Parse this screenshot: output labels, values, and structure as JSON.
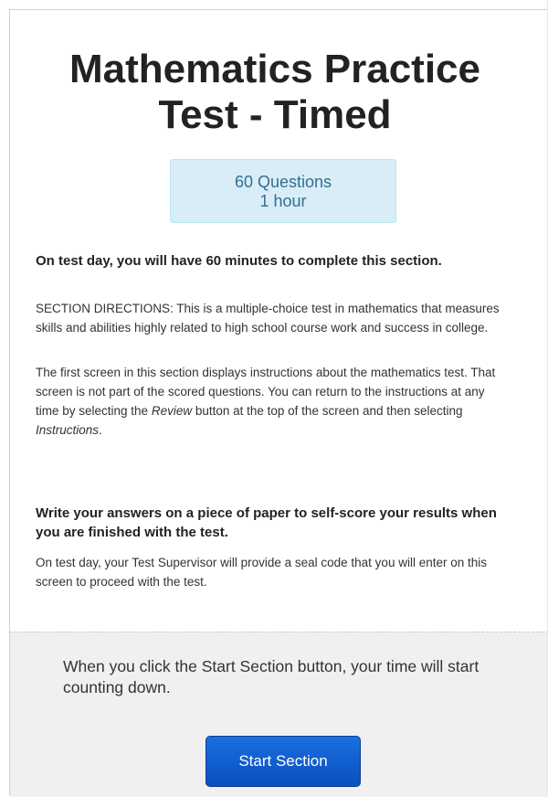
{
  "page": {
    "title_line1": "Mathematics Practice",
    "title_line2": "Test - Timed"
  },
  "info_box": {
    "questions": "60 Questions",
    "duration": "1 hour"
  },
  "instructions": {
    "lead": "On test day, you will have 60 minutes to complete this section.",
    "section_directions": "SECTION DIRECTIONS: This is a multiple-choice test in mathematics that measures skills and abilities highly related to high school course work and success in college.",
    "para2_part1": "The first screen in this section displays instructions about the mathematics test. That screen is not part of the scored questions. You can return to the instructions at any time by selecting the ",
    "para2_review": "Review",
    "para2_part2": " button at the top of the screen and then selecting ",
    "para2_instructions": "Instructions",
    "para2_part3": ".",
    "write_answers": "Write your answers on a piece of paper to self-score your results when you are finished with the test.",
    "seal_code": "On test day, your Test Supervisor will provide a seal code that you will enter on this screen to proceed with the test."
  },
  "footer": {
    "note": "When you click the Start Section button, your time will start counting down.",
    "start_button_label": "Start Section"
  }
}
